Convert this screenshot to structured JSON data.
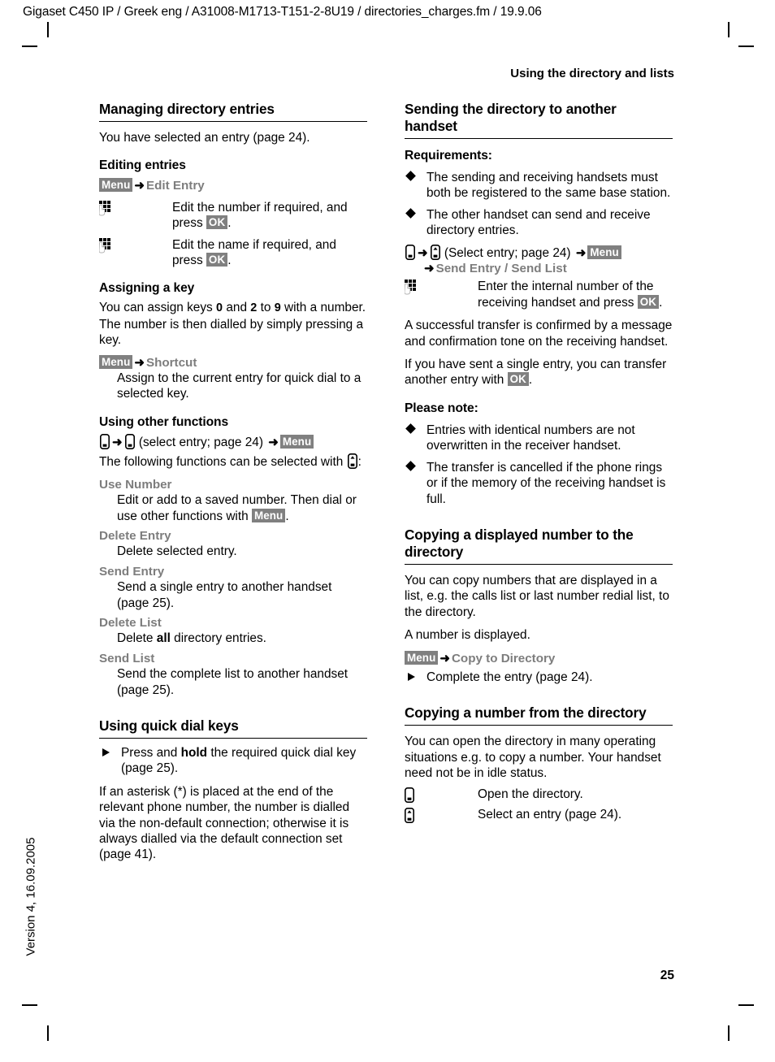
{
  "file_header": "Gigaset C450 IP / Greek eng / A31008-M1713-T151-2-8U19 / directories_charges.fm / 19.9.06",
  "version_side": "Version 4, 16.09.2005",
  "running_head": "Using the directory and lists",
  "page_number": "25",
  "badges": {
    "menu": "Menu",
    "ok": "OK"
  },
  "colors": {
    "badge_bg": "#808080",
    "badge_fg": "#ffffff",
    "menu_label": "#7d7d7d",
    "text": "#000000"
  },
  "left_column": {
    "section_title": "Managing directory entries",
    "intro": "You have selected an entry (page 24).",
    "editing": {
      "heading": "Editing entries",
      "path_target": "Edit Entry",
      "steps": [
        {
          "icon": "keypad-icon",
          "text_before": "Edit the number if required, and press ",
          "badge": "OK",
          "text_after": "."
        },
        {
          "icon": "keypad-icon",
          "text_before": "Edit the name if required, and press ",
          "badge": "OK",
          "text_after": "."
        }
      ]
    },
    "assigning": {
      "heading": "Assigning a key",
      "body_1": "You can assign keys ",
      "key_a": "0",
      "body_2": " and ",
      "key_b": "2",
      "body_3": " to ",
      "key_c": "9",
      "body_4": " with a number. The number is then dialled by simply pressing a key.",
      "path_target": "Shortcut",
      "path_desc": "Assign to the current entry for quick dial to a selected key."
    },
    "other_functions": {
      "heading": "Using other functions",
      "path_mid": "(select entry; page 24)",
      "intro_before": "The following functions can be selected with ",
      "intro_after": ":",
      "items": [
        {
          "label": "Use Number",
          "desc_before": "Edit or add to a saved number. Then dial or use other functions with ",
          "badge": "Menu",
          "desc_after": "."
        },
        {
          "label": "Delete Entry",
          "desc_before": "Delete selected entry.",
          "badge": "",
          "desc_after": ""
        },
        {
          "label": "Send Entry",
          "desc_before": "Send a single entry to another handset (page 25).",
          "badge": "",
          "desc_after": ""
        },
        {
          "label": "Delete List",
          "desc_before": "Delete ",
          "bold": "all",
          "desc_after": " directory entries."
        },
        {
          "label": "Send List",
          "desc_before": "Send the complete list to another handset (page 25).",
          "badge": "",
          "desc_after": ""
        }
      ]
    },
    "quick_dial": {
      "heading": "Using quick dial keys",
      "bullet_before": "Press and ",
      "bullet_bold": "hold",
      "bullet_after": " the required quick dial key (page 25).",
      "body": "If an asterisk (*) is placed at the end of the relevant phone number, the number is dialled via the non-default connection; otherwise it is always dialled via the default connection set (page 41)."
    }
  },
  "right_column": {
    "sending": {
      "section_title": "Sending the directory to another handset",
      "requirements_heading": "Requirements:",
      "requirements": [
        "The sending and receiving handsets must both be registered to the same base station.",
        "The other handset can send and receive directory entries."
      ],
      "path_mid": "(Select entry; page 24)",
      "path_targets": "Send Entry / Send List",
      "step": {
        "icon": "keypad-icon",
        "text_before": "Enter the internal number of the receiving handset and press ",
        "badge": "OK",
        "text_after": "."
      },
      "note_1": "A successful transfer is confirmed by a message and confirmation tone on the receiving handset.",
      "note_2_before": "If you have sent a single entry, you can transfer another entry with ",
      "note_2_badge": "OK",
      "note_2_after": ".",
      "please_note_heading": "Please note:",
      "please_note": [
        "Entries with identical numbers are not overwritten in the receiver handset.",
        "The transfer is cancelled if the phone rings or if the memory of the receiving handset is full."
      ]
    },
    "copying_to": {
      "section_title": "Copying a displayed number to the directory",
      "body": "You can copy numbers that are displayed in a list, e.g. the calls list or last number redial list, to the directory.",
      "body_2": "A number is displayed.",
      "path_target": "Copy to Directory",
      "bullet": "Complete the entry (page 24)."
    },
    "copying_from": {
      "section_title": "Copying a number from the directory",
      "body": "You can open the directory in many operating situations e.g. to copy a number. Your handset need not be in idle status.",
      "steps": [
        {
          "icon": "directory-key-icon",
          "text": "Open the directory."
        },
        {
          "icon": "nav-key-icon",
          "text": "Select an entry (page 24)."
        }
      ]
    }
  }
}
